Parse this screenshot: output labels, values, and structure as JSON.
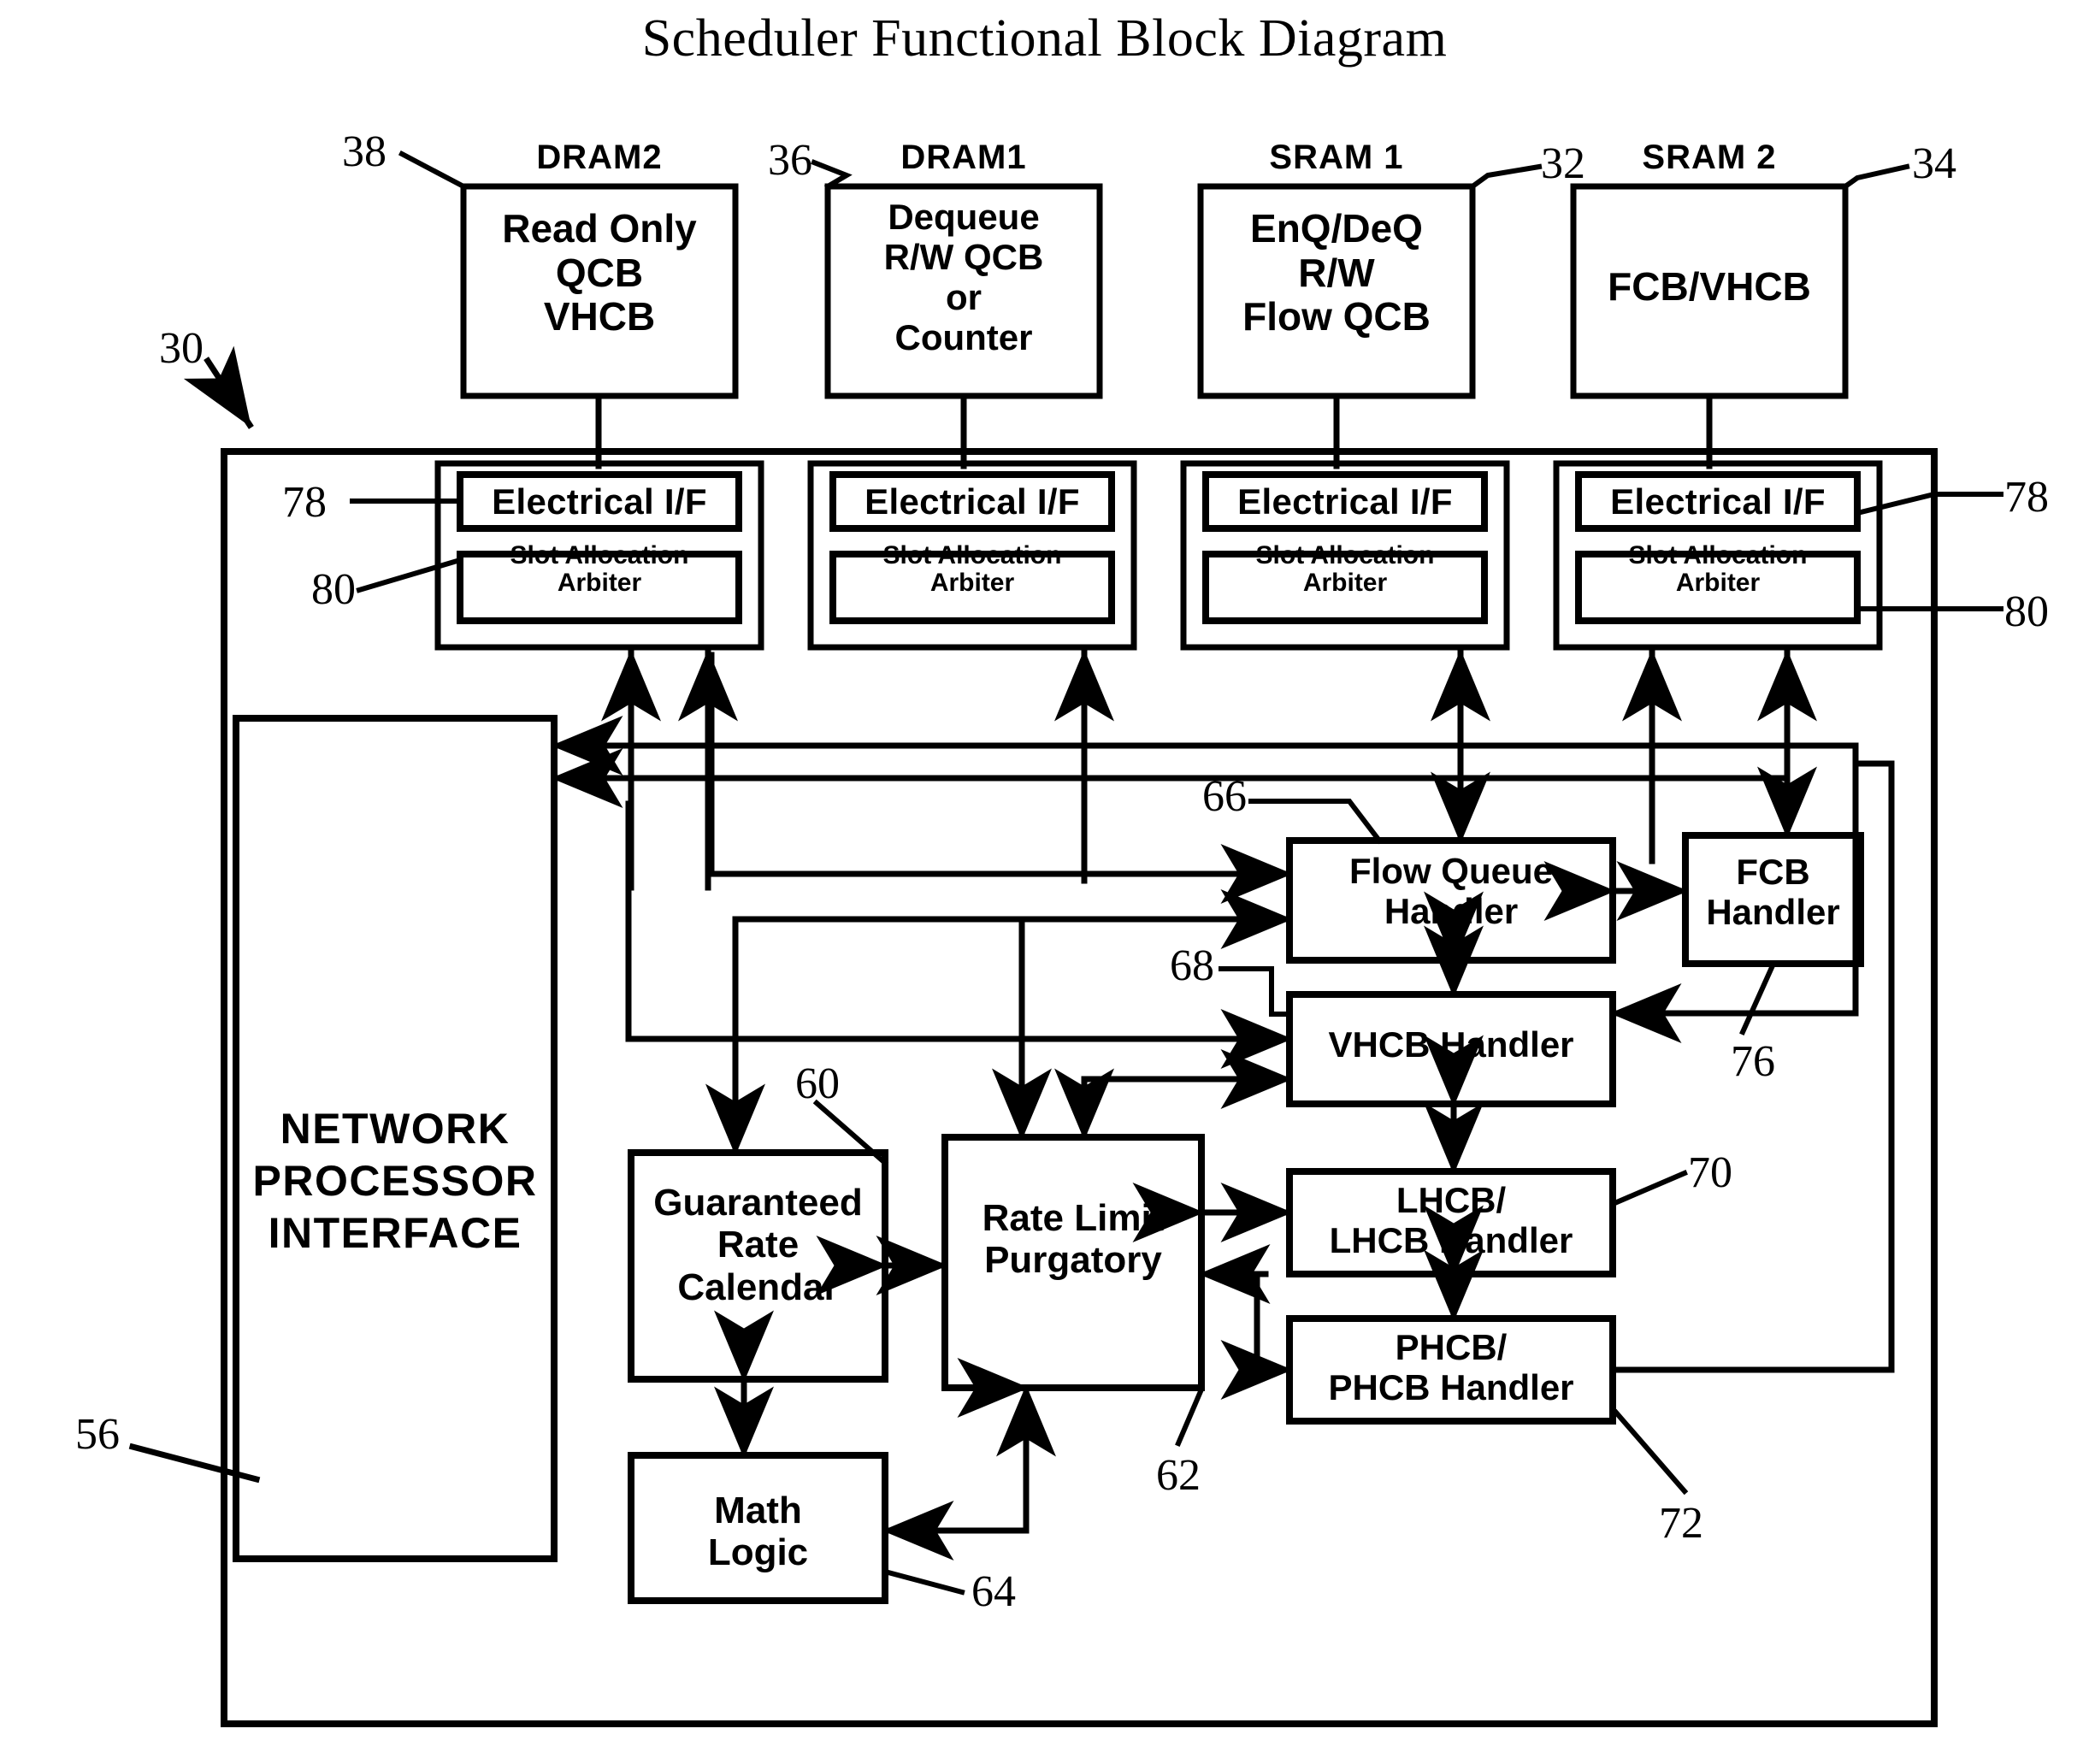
{
  "title": "Scheduler Functional Block Diagram",
  "memories": [
    {
      "id": "dram2",
      "caption": "DRAM2",
      "ref": "38",
      "lines": [
        "Read Only",
        "QCB",
        "VHCB"
      ]
    },
    {
      "id": "dram1",
      "caption": "DRAM1",
      "ref": "36",
      "lines": [
        "Dequeue",
        "R/W QCB",
        "or",
        "Counter"
      ]
    },
    {
      "id": "sram1",
      "caption": "SRAM 1",
      "ref": "32",
      "lines": [
        "EnQ/DeQ",
        "R/W",
        "Flow QCB"
      ]
    },
    {
      "id": "sram2",
      "caption": "SRAM 2",
      "ref": "34",
      "lines": [
        "FCB/VHCB"
      ]
    }
  ],
  "interfaces": {
    "electrical_if_label": "Electrical I/F",
    "electrical_if_ref": "78",
    "arbiter_line1": "Slot Allocation",
    "arbiter_line2": "Arbiter",
    "arbiter_ref": "80",
    "count": 4
  },
  "chip": {
    "ref": "30"
  },
  "npi": {
    "lines": [
      "NETWORK",
      "PROCESSOR",
      "INTERFACE"
    ],
    "ref": "56"
  },
  "blocks": [
    {
      "id": "flow-queue-handler",
      "ref": "66",
      "lines": [
        "Flow Queue",
        "Handler"
      ]
    },
    {
      "id": "fcb-handler",
      "ref": "76",
      "lines": [
        "FCB",
        "Handler"
      ]
    },
    {
      "id": "vhcb-handler",
      "ref": "68",
      "lines": [
        "VHCB Handler"
      ]
    },
    {
      "id": "lhcb-handler",
      "ref": "70",
      "lines": [
        "LHCB/",
        "LHCB Handler"
      ]
    },
    {
      "id": "phcb-handler",
      "ref": "72",
      "lines": [
        "PHCB/",
        "PHCB Handler"
      ]
    },
    {
      "id": "guaranteed-rate-calendar",
      "ref": "60",
      "lines": [
        "Guaranteed",
        "Rate",
        "Calendar"
      ]
    },
    {
      "id": "rate-limit-purgatory",
      "ref": "62",
      "lines": [
        "Rate Limit",
        "Purgatory"
      ]
    },
    {
      "id": "math-logic",
      "ref": "64",
      "lines": [
        "Math",
        "Logic"
      ]
    }
  ],
  "colors": {
    "ink": "#000000",
    "paper": "#ffffff"
  }
}
